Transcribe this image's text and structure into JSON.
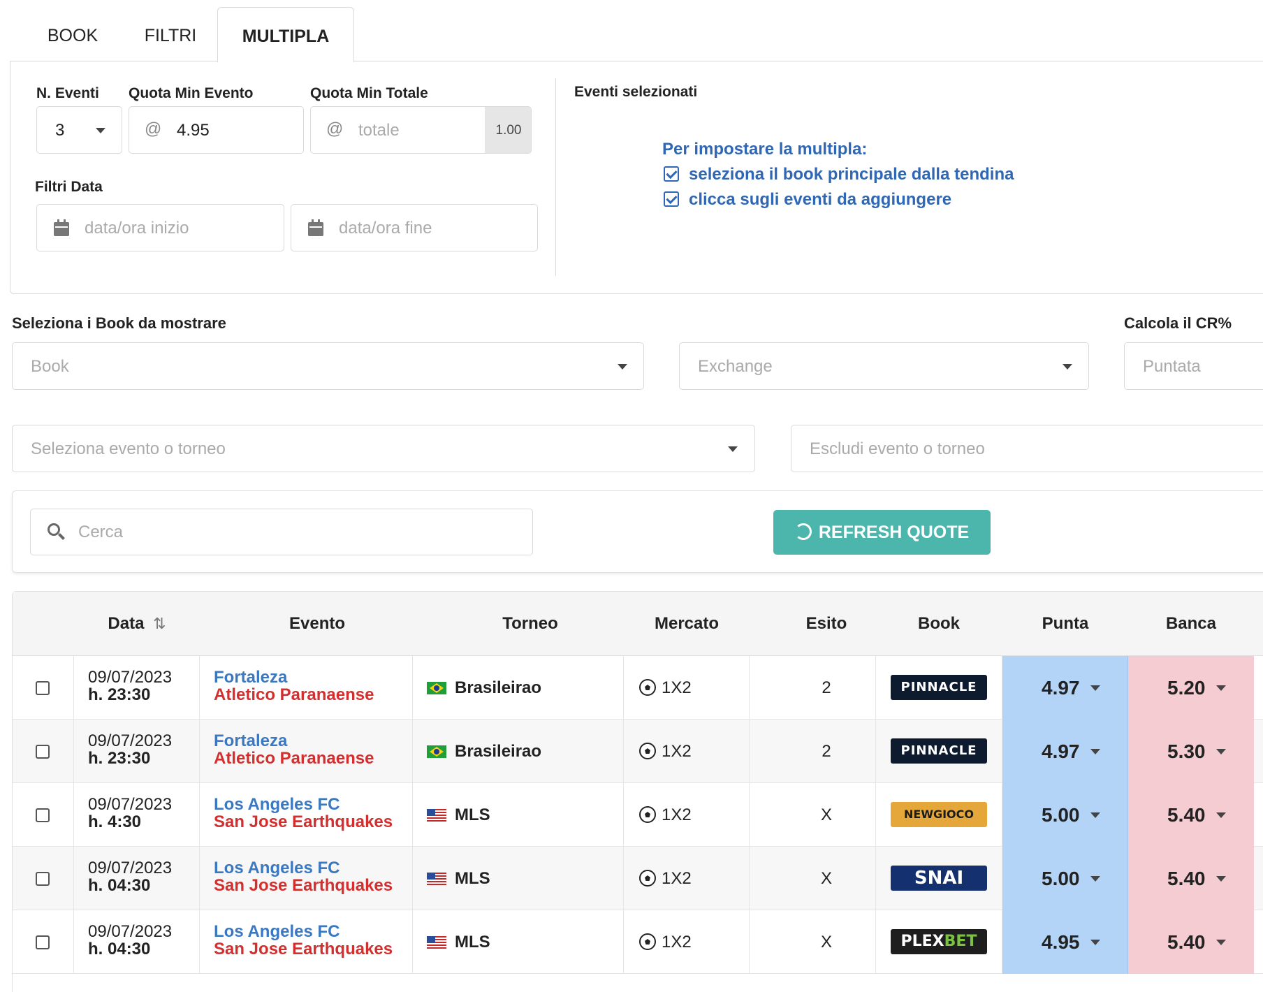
{
  "tabs": [
    {
      "label": "BOOK",
      "active": false
    },
    {
      "label": "FILTRI",
      "active": false
    },
    {
      "label": "MULTIPLA",
      "active": true
    }
  ],
  "multipla": {
    "n_eventi_label": "N. Eventi",
    "n_eventi_value": "3",
    "quota_min_evento_label": "Quota Min Evento",
    "quota_min_evento_value": "4.95",
    "quota_min_totale_label": "Quota Min Totale",
    "quota_min_totale_placeholder": "totale",
    "quota_totale_addon": "1.00",
    "at_symbol": "@",
    "filtri_data_label": "Filtri Data",
    "data_inizio_placeholder": "data/ora inizio",
    "data_fine_placeholder": "data/ora fine",
    "eventi_selezionati_label": "Eventi selezionati",
    "info_title": "Per impostare la multipla:",
    "info_items": [
      "seleziona il book principale dalla tendina",
      "clicca sugli eventi da aggiungere"
    ]
  },
  "filters": {
    "book_label": "Seleziona i Book da mostrare",
    "book_placeholder": "Book",
    "exchange_placeholder": "Exchange",
    "cr_label": "Calcola il CR%",
    "puntata_placeholder": "Puntata",
    "event_select_placeholder": "Seleziona evento o torneo",
    "event_exclude_placeholder": "Escludi evento o torneo"
  },
  "search": {
    "placeholder": "Cerca",
    "refresh_label": "REFRESH QUOTE"
  },
  "table": {
    "headers": {
      "data": "Data",
      "evento": "Evento",
      "torneo": "Torneo",
      "mercato": "Mercato",
      "esito": "Esito",
      "book": "Book",
      "punta": "Punta",
      "banca": "Banca"
    },
    "rows": [
      {
        "date": "09/07/2023",
        "hour": "h. 23:30",
        "home": "Fortaleza",
        "away": "Atletico Paranaense",
        "tournament": "Brasileirao",
        "flag": "br",
        "market": "1X2",
        "outcome": "2",
        "book": "PINNACLE",
        "book_style": "pinn",
        "punta": "4.97",
        "banca": "5.20"
      },
      {
        "date": "09/07/2023",
        "hour": "h. 23:30",
        "home": "Fortaleza",
        "away": "Atletico Paranaense",
        "tournament": "Brasileirao",
        "flag": "br",
        "market": "1X2",
        "outcome": "2",
        "book": "PINNACLE",
        "book_style": "pinn",
        "punta": "4.97",
        "banca": "5.30"
      },
      {
        "date": "09/07/2023",
        "hour": "h. 4:30",
        "home": "Los Angeles FC",
        "away": "San Jose Earthquakes",
        "tournament": "MLS",
        "flag": "us",
        "market": "1X2",
        "outcome": "X",
        "book": "NEWGIOCO",
        "book_style": "newg",
        "punta": "5.00",
        "banca": "5.40"
      },
      {
        "date": "09/07/2023",
        "hour": "h. 04:30",
        "home": "Los Angeles FC",
        "away": "San Jose Earthquakes",
        "tournament": "MLS",
        "flag": "us",
        "market": "1X2",
        "outcome": "X",
        "book": "SNAI",
        "book_style": "snai",
        "punta": "5.00",
        "banca": "5.40"
      },
      {
        "date": "09/07/2023",
        "hour": "h. 04:30",
        "home": "Los Angeles FC",
        "away": "San Jose Earthquakes",
        "tournament": "MLS",
        "flag": "us",
        "market": "1X2",
        "outcome": "X",
        "book": "PLEX",
        "book_suffix": "BET",
        "book_style": "plex",
        "punta": "4.95",
        "banca": "5.40"
      }
    ]
  },
  "colors": {
    "accent_teal": "#4db6ac",
    "info_blue": "#2f67b5",
    "home_blue": "#3b78c2",
    "away_red": "#d32f2f",
    "punta_bg": "#b3d4f6",
    "banca_bg": "#f4ccd2"
  }
}
